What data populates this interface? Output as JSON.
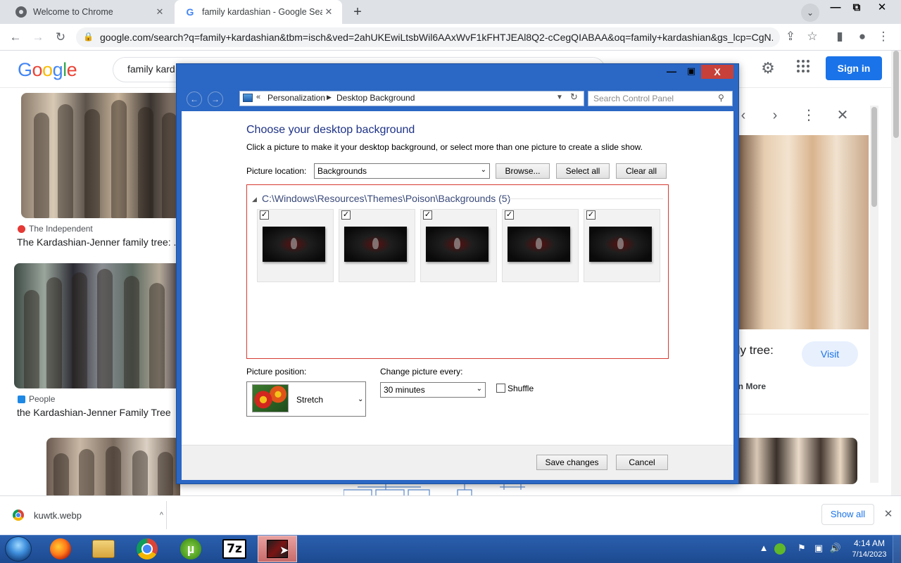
{
  "browser": {
    "tabs": [
      {
        "title": "Welcome to Chrome",
        "close": "✕"
      },
      {
        "title": "family kardashian - Google Search",
        "close": "✕"
      }
    ],
    "new_tab": "+",
    "tab_search": "⌄",
    "window_controls": {
      "minimize": "—",
      "maximize": "⧉",
      "close": "✕"
    },
    "nav": {
      "back": "←",
      "forward": "→",
      "reload": "↻"
    },
    "url": "google.com/search?q=family+kardashian&tbm=isch&ved=2ahUKEwiLtsbWil6AAxWvF1kFHTJEAl8Q2-cCegQIABAA&oq=family+kardashian&gs_lcp=CgN...",
    "toolbar_icons": {
      "share": "⇪",
      "bookmark": "☆",
      "side_panel": "▮",
      "profile": "●",
      "menu": "⋮"
    }
  },
  "google": {
    "logo": [
      "G",
      "o",
      "o",
      "g",
      "l",
      "e"
    ],
    "search_value": "family kard",
    "settings": "⚙",
    "apps": "⋮⋮⋮",
    "sign_in": "Sign in",
    "results": [
      {
        "source": "The Independent",
        "caption": "The Kardashian-Jenner family tree: ..."
      },
      {
        "source": "People",
        "caption": "the Kardashian-Jenner Family Tree"
      }
    ],
    "preview": {
      "prev": "‹",
      "next": "›",
      "more": "⋮",
      "close": "✕",
      "title_fragment": "ily tree:",
      "visit": "Visit",
      "learn_more": "rn More"
    }
  },
  "downloads": {
    "file": "kuwtk.webp",
    "chevron": "^",
    "show_all": "Show all",
    "close": "✕"
  },
  "control_panel": {
    "title_controls": {
      "minimize": "—",
      "maximize": "▣",
      "close": "X"
    },
    "nav": {
      "back": "←",
      "forward": "→"
    },
    "address": {
      "separator": "«",
      "crumbs": [
        "Personalization",
        "Desktop Background"
      ],
      "arrow": "▶"
    },
    "search_placeholder": "Search Control Panel",
    "heading": "Choose your desktop background",
    "description": "Click a picture to make it your desktop background, or select more than one picture to create a slide show.",
    "picture_location_label": "Picture location:",
    "picture_location_value": "Backgrounds",
    "buttons": {
      "browse": "Browse...",
      "select_all": "Select all",
      "clear_all": "Clear all",
      "save": "Save changes",
      "cancel": "Cancel"
    },
    "group_header": "C:\\Windows\\Resources\\Themes\\Poison\\Backgrounds (5)",
    "pictures": [
      {
        "checked": "✓"
      },
      {
        "checked": "✓"
      },
      {
        "checked": "✓"
      },
      {
        "checked": "✓"
      },
      {
        "checked": "✓"
      }
    ],
    "picture_position_label": "Picture position:",
    "picture_position_value": "Stretch",
    "change_every_label": "Change picture every:",
    "change_every_value": "30 minutes",
    "shuffle_label": "Shuffle",
    "shuffle_checked": false
  },
  "taskbar": {
    "apps": [
      "Firefox",
      "File Explorer",
      "Google Chrome",
      "uTorrent",
      "7-Zip",
      "Desktop Background"
    ],
    "seven_zip_text": "7z",
    "utorrent_text": "µ",
    "tray": {
      "up": "▲",
      "flag": "⚑",
      "network": "▣",
      "volume": "🔊"
    },
    "clock_time": "4:14 AM",
    "clock_date": "7/14/2023"
  }
}
